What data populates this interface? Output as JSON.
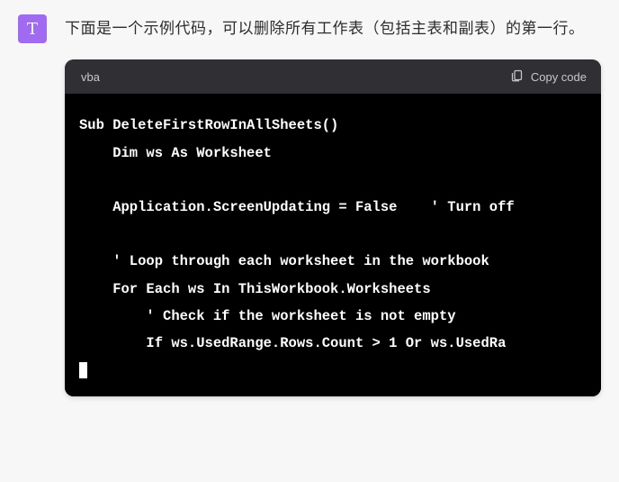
{
  "avatar": {
    "letter": "T"
  },
  "message": {
    "intro": "下面是一个示例代码，可以删除所有工作表（包括主表和副表）的第一行。"
  },
  "codeblock": {
    "language": "vba",
    "copy_label": "Copy code",
    "lines": [
      "Sub DeleteFirstRowInAllSheets()",
      "    Dim ws As Worksheet",
      "",
      "    Application.ScreenUpdating = False    ' Turn off",
      "",
      "    ' Loop through each worksheet in the workbook",
      "    For Each ws In ThisWorkbook.Worksheets",
      "        ' Check if the worksheet is not empty",
      "        If ws.UsedRange.Rows.Count > 1 Or ws.UsedRa"
    ]
  }
}
